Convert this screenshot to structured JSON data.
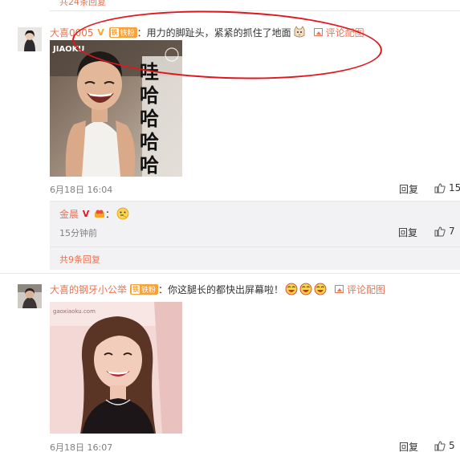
{
  "top": {
    "more_link": "共24条回复"
  },
  "comment1": {
    "author": "大喜0005",
    "fan_level": "铁粉",
    "text": "：用力的脚趾头，紧紧的抓住了地面",
    "pic_link": "评论配图",
    "image_watermark": "JIAOKU",
    "image_text": [
      "哇",
      "哈",
      "哈",
      "哈",
      "哈"
    ],
    "date": "6月18日 16:04",
    "reply_label": "回复",
    "like_count": "15"
  },
  "reply1": {
    "author": "金晨",
    "text": "：",
    "time": "15分钟前",
    "reply_label": "回复",
    "like_count": "7"
  },
  "replies_more": "共9条回复",
  "comment2": {
    "author": "大喜的钢牙小公举",
    "fan_level": "铁粉",
    "text": "：你这腿长的都快出屏幕啦！",
    "pic_link": "评论配图",
    "image_watermark": "gaoxiaoku.com",
    "date": "6月18日 16:07",
    "reply_label": "回复",
    "like_count": "5"
  },
  "colors": {
    "link": "#eb7350",
    "annotation": "#e0171f",
    "reply_bg": "#f2f2f5"
  }
}
